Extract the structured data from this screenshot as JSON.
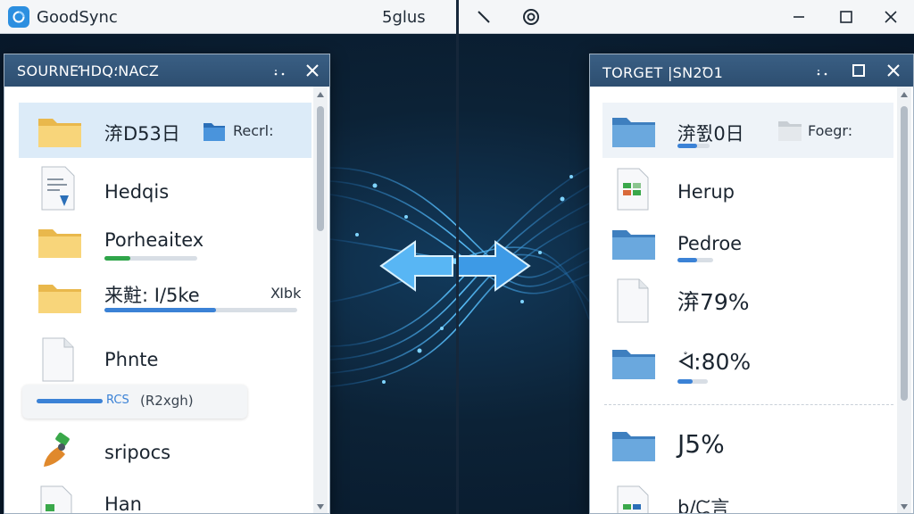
{
  "app": {
    "title": "GoodSync",
    "menu_label": "5glus",
    "accent": "#2c8fe0"
  },
  "window_controls": [
    "minimize-icon",
    "maximize-icon",
    "close-icon"
  ],
  "toolbar_icons": [
    "sync-line-icon",
    "target-icon"
  ],
  "sync_arrows": {
    "icon": "bidirectional-sync-arrows-icon",
    "color": "#4aa8f0"
  },
  "source": {
    "title": "SOURNEꞪDQ؛NACZ",
    "items": [
      {
        "icon": "folder-icon",
        "name": "㳰D53⽇",
        "badge_icon": "blue-folder-icon",
        "badge_text": "Recrl:",
        "selected": true
      },
      {
        "icon": "document-icon",
        "name": "Hedqis"
      },
      {
        "icon": "folder-icon",
        "name": "Porheaitex",
        "progress": 0.28,
        "progress_color": "#2fa54a"
      },
      {
        "icon": "folder-icon",
        "name": "来黈: I/5ke",
        "aux": "Ⅺbk",
        "progress": 0.58,
        "progress_color": "#3b82d6"
      },
      {
        "icon": "blank-document-icon",
        "name": "Phnte"
      },
      {
        "icon": "usb-drive-icon",
        "name": "sripocs"
      },
      {
        "icon": "document-icon",
        "name": "Han"
      }
    ],
    "status": {
      "label": "RCS",
      "text": "(R2xgh)",
      "progress": 1.0,
      "progress_color": "#3b82d6"
    }
  },
  "target": {
    "title": "TORGET |SN2Ꝺ1",
    "items": [
      {
        "icon": "blue-folder-icon",
        "name": "㳰쮨0⽇",
        "badge_icon": "gray-folder-icon",
        "badge_text": "Foegr:",
        "progress": 0.6,
        "progress_color": "#3b82d6",
        "selected": true
      },
      {
        "icon": "spreadsheet-icon",
        "name": "Herup"
      },
      {
        "icon": "blue-folder-icon",
        "name": "Pedroe",
        "progress": 0.55,
        "progress_color": "#3b82d6"
      },
      {
        "icon": "blank-document-icon",
        "name": "㳰79%"
      },
      {
        "icon": "blue-folder-icon",
        "name": "ᢱ:80%",
        "progress": 0.5,
        "progress_color": "#3b82d6"
      },
      {
        "icon": "blue-folder-icon",
        "name": "J5%"
      },
      {
        "icon": "spreadsheet-icon",
        "name": "b/ᙅ⾔"
      }
    ]
  }
}
